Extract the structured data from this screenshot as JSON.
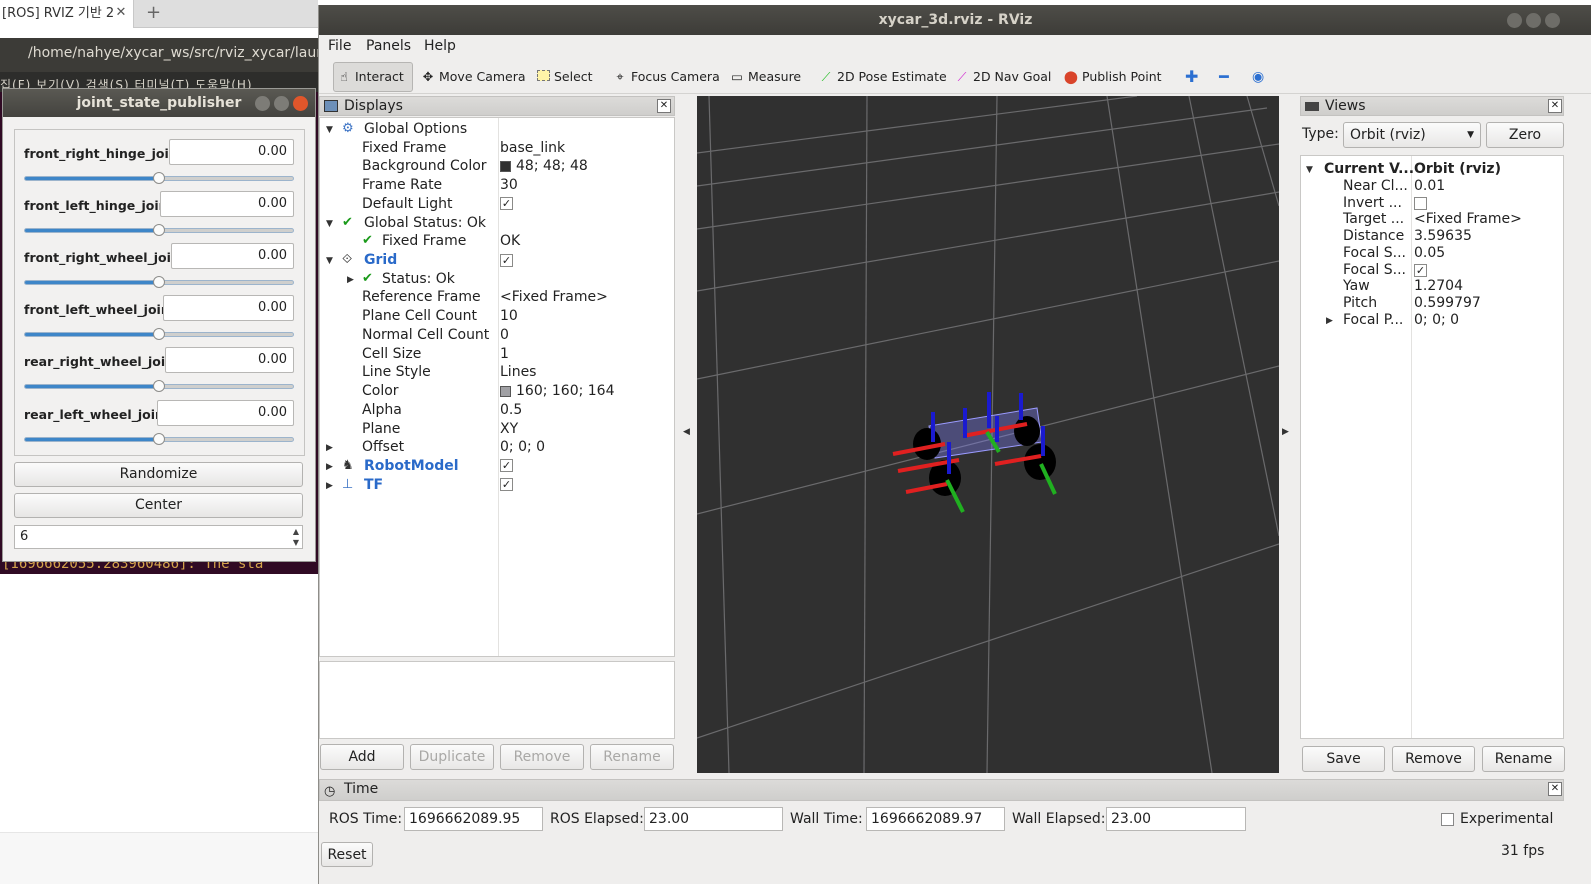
{
  "browser": {
    "tab_title": "[ROS] RVIZ 기반 2",
    "close_glyph": "✕",
    "new_tab_glyph": "+"
  },
  "terminal": {
    "path": "/home/nahye/xycar_ws/src/rviz_xycar/laun",
    "menu": "집(F)  보기(V)  검색(S)  터미널(T)  도움말(H)",
    "log_line": "[1696662055.283960486]: The  sta"
  },
  "joint_state_publisher": {
    "title": "joint_state_publisher",
    "joints": [
      {
        "name": "front_right_hinge_joint",
        "value": "0.00",
        "slider_fraction": 0.5
      },
      {
        "name": "front_left_hinge_joint",
        "value": "0.00",
        "slider_fraction": 0.5
      },
      {
        "name": "front_right_wheel_joint",
        "value": "0.00",
        "slider_fraction": 0.5
      },
      {
        "name": "front_left_wheel_joint",
        "value": "0.00",
        "slider_fraction": 0.5
      },
      {
        "name": "rear_right_wheel_joint",
        "value": "0.00",
        "slider_fraction": 0.5
      },
      {
        "name": "rear_left_wheel_joint",
        "value": "0.00",
        "slider_fraction": 0.5
      }
    ],
    "randomize_label": "Randomize",
    "center_label": "Center",
    "spin_value": "6"
  },
  "rviz": {
    "title": "xycar_3d.rviz - RViz",
    "menu": {
      "file": "File",
      "panels": "Panels",
      "help": "Help"
    },
    "toolbar": {
      "interact": "Interact",
      "move_camera": "Move Camera",
      "select": "Select",
      "focus_camera": "Focus Camera",
      "measure": "Measure",
      "pose_estimate": "2D Pose Estimate",
      "nav_goal": "2D Nav Goal",
      "publish_point": "Publish Point"
    },
    "displays": {
      "title": "Displays",
      "rows": [
        {
          "name": "Global Options",
          "value": ""
        },
        {
          "name": "Fixed Frame",
          "value": "base_link"
        },
        {
          "name": "Background Color",
          "value": "48; 48; 48"
        },
        {
          "name": "Frame Rate",
          "value": "30"
        },
        {
          "name": "Default Light",
          "value": ""
        },
        {
          "name": "Global Status: Ok",
          "value": ""
        },
        {
          "name": "Fixed Frame",
          "value": "OK"
        },
        {
          "name": "Grid",
          "value": ""
        },
        {
          "name": "Status: Ok",
          "value": ""
        },
        {
          "name": "Reference Frame",
          "value": "<Fixed Frame>"
        },
        {
          "name": "Plane Cell Count",
          "value": "10"
        },
        {
          "name": "Normal Cell Count",
          "value": "0"
        },
        {
          "name": "Cell Size",
          "value": "1"
        },
        {
          "name": "Line Style",
          "value": "Lines"
        },
        {
          "name": "Color",
          "value": "160; 160; 164"
        },
        {
          "name": "Alpha",
          "value": "0.5"
        },
        {
          "name": "Plane",
          "value": "XY"
        },
        {
          "name": "Offset",
          "value": "0; 0; 0"
        },
        {
          "name": "RobotModel",
          "value": ""
        },
        {
          "name": "TF",
          "value": ""
        }
      ],
      "buttons": {
        "add": "Add",
        "duplicate": "Duplicate",
        "remove": "Remove",
        "rename": "Rename"
      }
    },
    "views": {
      "title": "Views",
      "type_label": "Type:",
      "type_value": "Orbit (rviz)",
      "zero_label": "Zero",
      "rows": [
        {
          "name": "Current V...",
          "value": "Orbit (rviz)"
        },
        {
          "name": "Near Cl...",
          "value": "0.01"
        },
        {
          "name": "Invert ...",
          "value": ""
        },
        {
          "name": "Target ...",
          "value": "<Fixed Frame>"
        },
        {
          "name": "Distance",
          "value": "3.59635"
        },
        {
          "name": "Focal S...",
          "value": "0.05"
        },
        {
          "name": "Focal S...",
          "value": ""
        },
        {
          "name": "Yaw",
          "value": "1.2704"
        },
        {
          "name": "Pitch",
          "value": "0.599797"
        },
        {
          "name": "Focal P...",
          "value": "0; 0; 0"
        }
      ],
      "buttons": {
        "save": "Save",
        "remove": "Remove",
        "rename": "Rename"
      }
    },
    "time": {
      "title": "Time",
      "ros_time_label": "ROS Time:",
      "ros_time": "1696662089.95",
      "ros_elapsed_label": "ROS Elapsed:",
      "ros_elapsed": "23.00",
      "wall_time_label": "Wall Time:",
      "wall_time": "1696662089.97",
      "wall_elapsed_label": "Wall Elapsed:",
      "wall_elapsed": "23.00",
      "experimental_label": "Experimental",
      "reset_label": "Reset",
      "fps": "31 fps"
    }
  },
  "colors": {
    "background_swatch": "#303030",
    "grid_swatch": "#a0a0a4",
    "accent_blue": "#2a6ac9"
  }
}
